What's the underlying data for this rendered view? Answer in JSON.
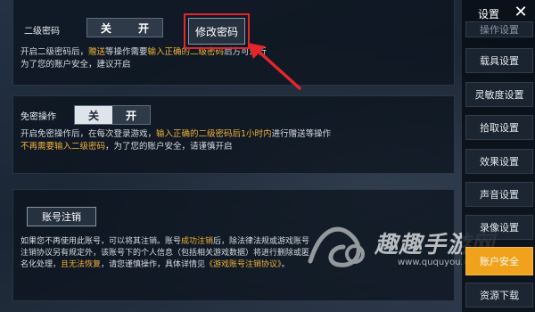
{
  "section_second_password": {
    "label": "二级密码",
    "toggle_off": "关",
    "toggle_on": "开",
    "change_password_button": "修改密码",
    "desc_line1_a": "开启二级密码后，",
    "desc_line1_b": "赠送",
    "desc_line1_c": "等操作需要",
    "desc_line1_d": "输入正确的二级密码",
    "desc_line1_e": "后方可进行",
    "desc_line2": "为了您的账户安全，建议开启"
  },
  "section_no_password": {
    "label": "免密操作",
    "toggle_off": "关",
    "toggle_on": "开",
    "desc_line1_a": "开启免密操作后，在每次登录游戏，",
    "desc_line1_b": "输入正确的二级密码后1小时内",
    "desc_line1_c": "进行赠送等操作",
    "desc_line2_a": "不再需要输入二级密码",
    "desc_line2_b": "，为了您的账户安全，请谨慎开启"
  },
  "section_account_cancel": {
    "button": "账号注销",
    "line1_a": "如果您不再使用此账号，可以将其注销。账号",
    "line1_b": "成功注销",
    "line1_c": "后，除法律法规或游戏账号",
    "line2": "注销协议另有规定外，该账号下的个人信息（包括相关游戏数据）将进行删除或匿",
    "line3_a": "名化处理，",
    "line3_b": "且无法恢复",
    "line3_c": "，请您谨慎操作，具体详情见",
    "line3_d": "《游戏账号注销协议》",
    "line3_e": "。"
  },
  "sidebar": {
    "title": "设置",
    "items": [
      {
        "label": "操作设置",
        "state": "faded"
      },
      {
        "label": "载具设置",
        "state": "normal"
      },
      {
        "label": "灵敏度设置",
        "state": "normal"
      },
      {
        "label": "拾取设置",
        "state": "normal"
      },
      {
        "label": "效果设置",
        "state": "normal"
      },
      {
        "label": "声音设置",
        "state": "normal"
      },
      {
        "label": "录像设置",
        "state": "normal"
      },
      {
        "label": "账户安全",
        "state": "active"
      },
      {
        "label": "资源下载",
        "state": "normal"
      }
    ]
  },
  "watermark": {
    "text": "趣趣手游网",
    "url": "www.ququyou.com"
  },
  "colors": {
    "accent": "#f0a21c",
    "highlight_text": "#f2b23c",
    "annotation_red": "#e3262b"
  },
  "icons": {
    "close": "close-icon",
    "arrow": "annotation-arrow-icon"
  }
}
